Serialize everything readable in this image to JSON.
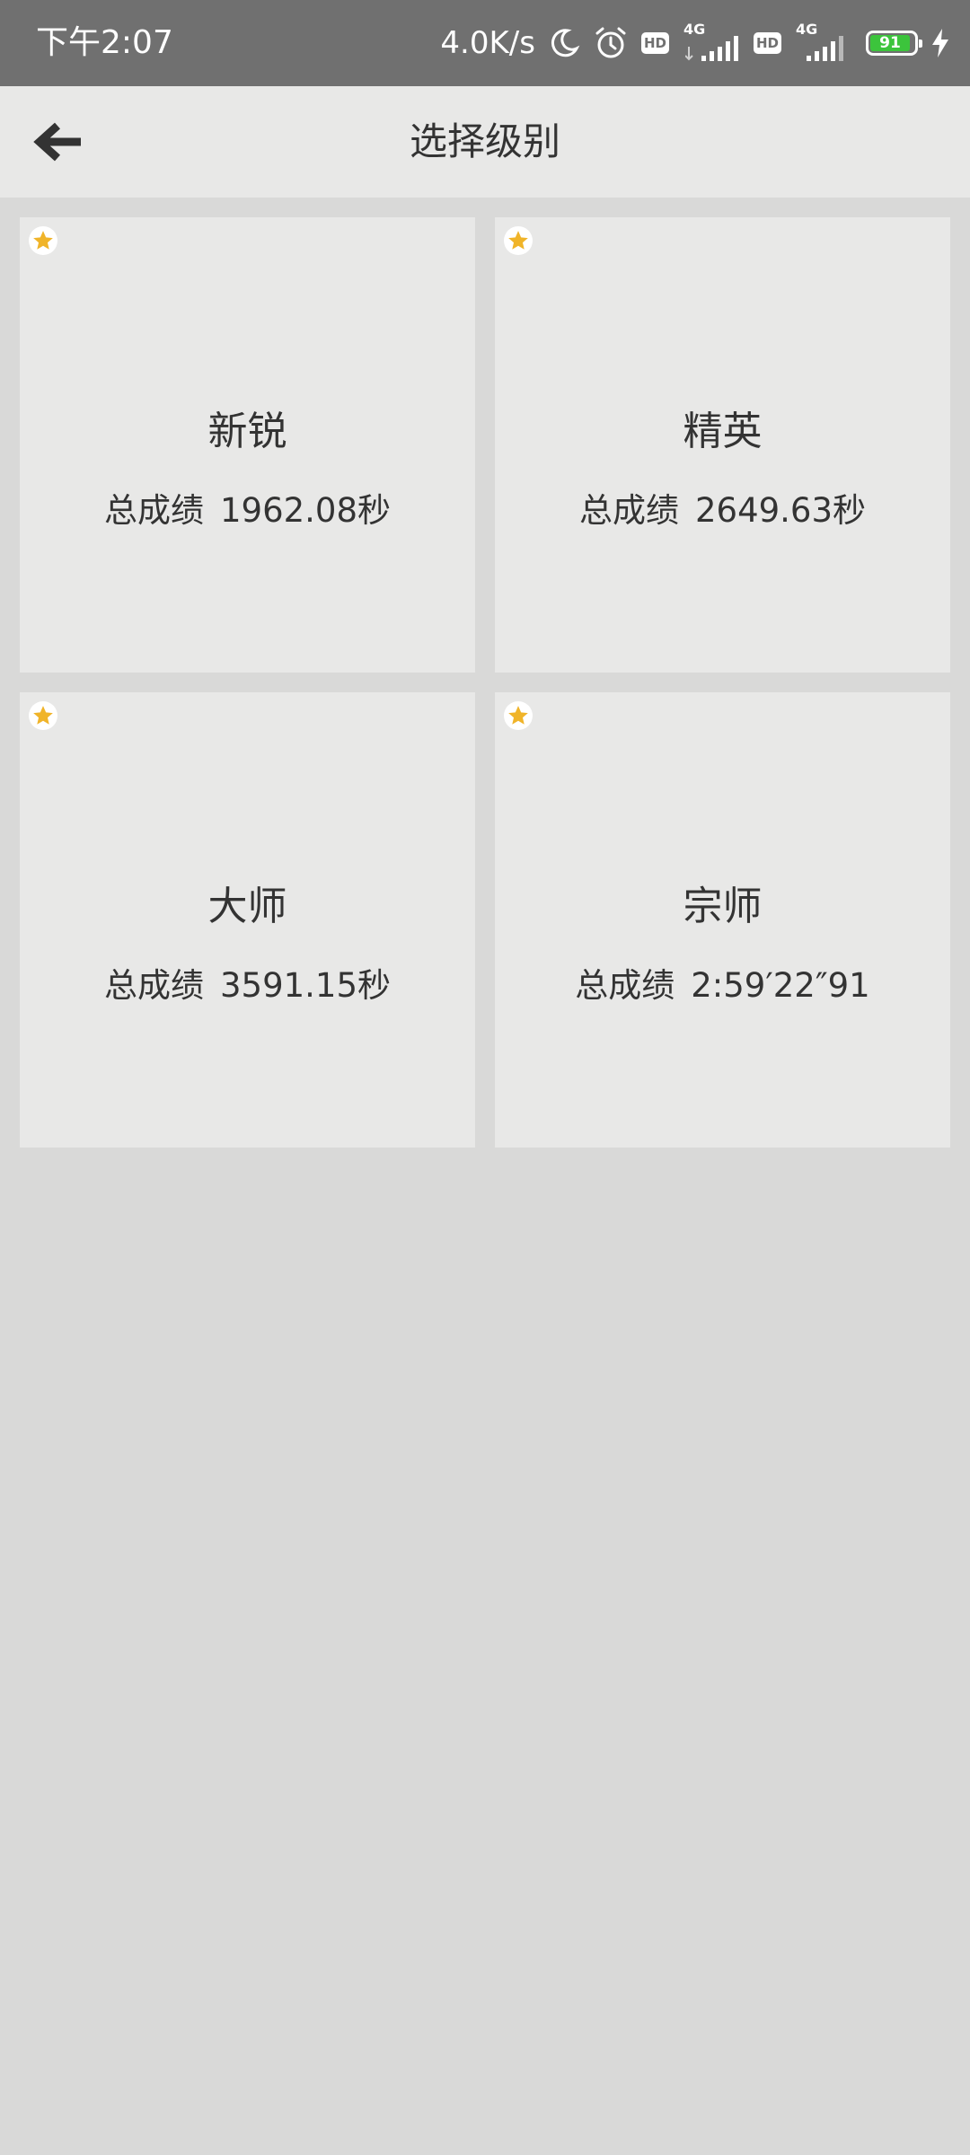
{
  "status_bar": {
    "time": "下午2:07",
    "net_speed": "4.0K/s",
    "hd1": "HD",
    "net1": "4G",
    "hd2": "HD",
    "net2": "4G",
    "battery": "91",
    "icons": [
      "moon-icon",
      "alarm-icon",
      "signal-icon",
      "battery-icon",
      "charging-icon"
    ]
  },
  "app_bar": {
    "title": "选择级别",
    "back_icon": "back-arrow-icon"
  },
  "score_label": "总成绩",
  "levels": [
    {
      "name": "新锐",
      "score": "1962.08秒"
    },
    {
      "name": "精英",
      "score": "2649.63秒"
    },
    {
      "name": "大师",
      "score": "3591.15秒"
    },
    {
      "name": "宗师",
      "score": "2:59′22″91"
    }
  ],
  "colors": {
    "status_bar": "#707070",
    "app_bar": "#e8e8e7",
    "background": "#d9d9d8",
    "card": "#e8e8e7",
    "star": "#f0b429",
    "battery": "#3cc43c"
  }
}
